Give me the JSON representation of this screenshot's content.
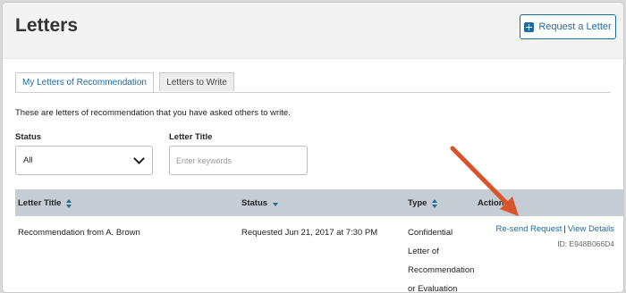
{
  "header": {
    "title": "Letters",
    "request_button_label": "Request a Letter",
    "request_button_icon": "plus-square-icon"
  },
  "tabs": [
    {
      "label": "My Letters of Recommendation",
      "active": true
    },
    {
      "label": "Letters to Write",
      "active": false
    }
  ],
  "intro_text": "These are letters of recommendation that you have asked others to write.",
  "filters": {
    "status_label": "Status",
    "status_value": "All",
    "title_label": "Letter Title",
    "title_placeholder": "Enter keywords"
  },
  "table": {
    "columns": [
      "Letter Title",
      "Status",
      "Type",
      "Action"
    ],
    "rows": [
      {
        "title": "Recommendation from A. Brown",
        "status": "Requested Jun 21, 2017 at 7:30 PM",
        "type_lines": [
          "Confidential",
          "Letter of",
          "Recommendation",
          "or Evaluation"
        ],
        "actions": [
          "Re-send Request",
          "View Details"
        ],
        "action_separator": "|",
        "record_id": "ID: E948B066D4"
      }
    ]
  },
  "colors": {
    "accent": "#1d6aa0",
    "table_header_bg": "#c6ccd3",
    "annotation_arrow": "#d9542b"
  }
}
